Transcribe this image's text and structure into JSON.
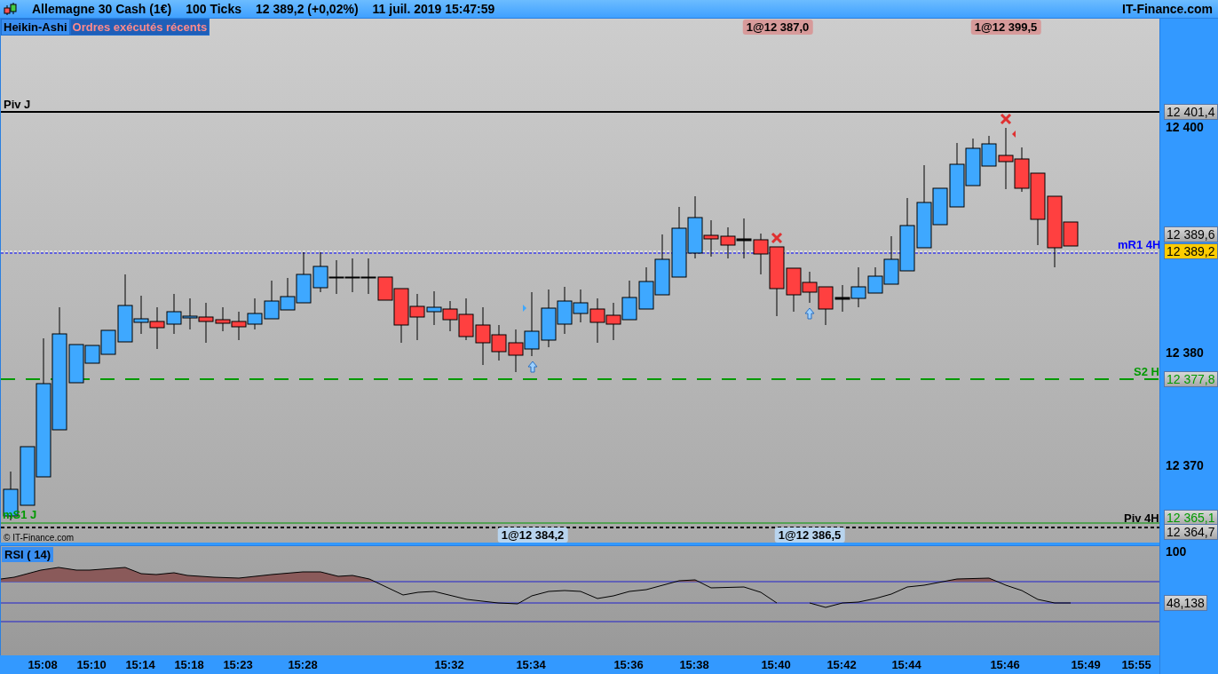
{
  "title_bar": {
    "instrument": "Allemagne 30 Cash (1€)",
    "period": "100 Ticks",
    "price": "12 389,2 (+0,02%)",
    "datetime": "11 juil. 2019 15:47:59",
    "brand": "IT-Finance.com"
  },
  "tabs": [
    {
      "label": "Heikin-Ashi",
      "kind": "chart"
    },
    {
      "label": "Ordres exécutés récents",
      "kind": "orders"
    }
  ],
  "price_chart": {
    "level_labels": [
      {
        "text": "Piv J",
        "color": "#000000"
      },
      {
        "text": "mR1 4H",
        "color": "#0000ff"
      },
      {
        "text": "S2 H",
        "color": "#009900"
      },
      {
        "text": "mS1 J",
        "color": "#009900"
      },
      {
        "text": "Piv 4H",
        "color": "#000000"
      }
    ],
    "orders": [
      {
        "text": "1@12 387,0",
        "kind": "sell"
      },
      {
        "text": "1@12 399,5",
        "kind": "sell"
      },
      {
        "text": "1@12 384,2",
        "kind": "buy"
      },
      {
        "text": "1@12 386,5",
        "kind": "buy"
      }
    ],
    "copyright": "© IT-Finance.com"
  },
  "price_axis": [
    {
      "text": "12 401,4",
      "kind": "level",
      "color": "#000000"
    },
    {
      "text": "12 400",
      "kind": "tick"
    },
    {
      "text": "12 389,6",
      "kind": "level",
      "color": "#000000"
    },
    {
      "text": "12 389,2",
      "kind": "current"
    },
    {
      "text": "12 380",
      "kind": "tick"
    },
    {
      "text": "12 377,8",
      "kind": "level",
      "color": "#009900"
    },
    {
      "text": "12 370",
      "kind": "tick"
    },
    {
      "text": "12 365,1",
      "kind": "level",
      "color": "#009900"
    },
    {
      "text": "12 364,7",
      "kind": "level",
      "color": "#000000"
    }
  ],
  "rsi": {
    "title": "RSI ( 14)",
    "axis": [
      {
        "text": "100",
        "kind": "tick"
      },
      {
        "text": "48,138",
        "kind": "level",
        "color": "#000000"
      }
    ]
  },
  "time_axis": [
    "15:08",
    "15:10",
    "15:14",
    "15:18",
    "15:23",
    "15:28",
    "15:32",
    "15:34",
    "15:36",
    "15:38",
    "15:40",
    "15:42",
    "15:44",
    "15:46",
    "15:49",
    "15:55"
  ]
}
